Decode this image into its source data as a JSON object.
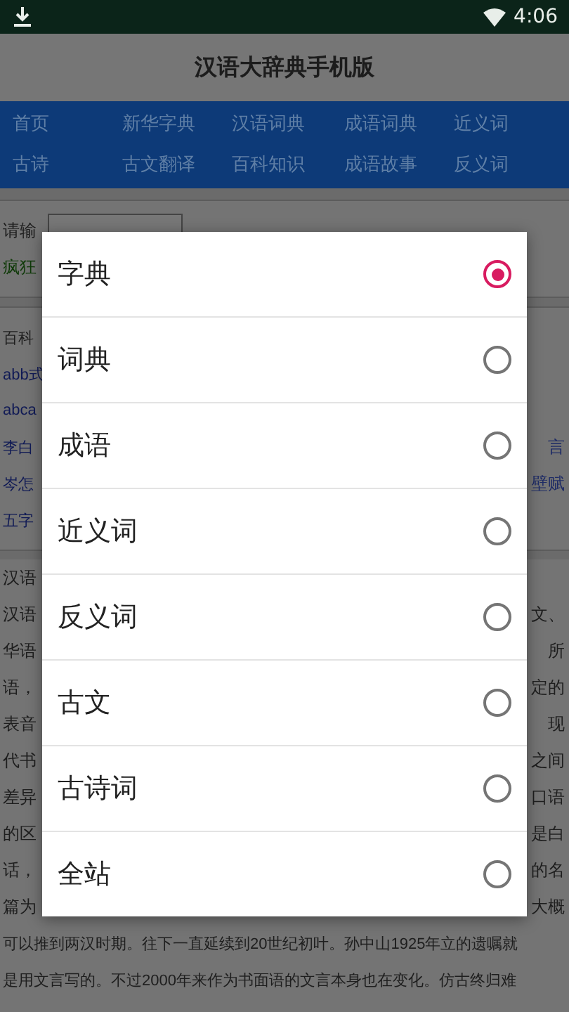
{
  "status_bar": {
    "time": "4:06"
  },
  "header": {
    "title": "汉语大辞典手机版"
  },
  "nav": [
    {
      "label": "首页"
    },
    {
      "label": "新华字典"
    },
    {
      "label": "汉语词典"
    },
    {
      "label": "成语词典"
    },
    {
      "label": "近义词"
    },
    {
      "label": "古诗"
    },
    {
      "label": "古文翻译"
    },
    {
      "label": "百科知识"
    },
    {
      "label": "成语故事"
    },
    {
      "label": "反义词"
    }
  ],
  "search_section": {
    "prompt": "请输",
    "hot": "疯狂"
  },
  "links_section": [
    {
      "left": "百科"
    },
    {
      "left": "abb式"
    },
    {
      "left": "abca"
    },
    {
      "left": "李白",
      "right": "言"
    },
    {
      "left": "岑怎",
      "right": "壁赋"
    },
    {
      "left": "五字"
    }
  ],
  "article": {
    "lines": [
      {
        "left": "汉语"
      },
      {
        "left": "汉语",
        "right": "文、"
      },
      {
        "left": "华语",
        "right": "所"
      },
      {
        "left": "语，",
        "right": "定的"
      },
      {
        "left": "表音",
        "right": "现"
      },
      {
        "left": "代书",
        "right": "之间"
      },
      {
        "left": "差异",
        "right": "口语"
      },
      {
        "left": "的区",
        "right": "是白"
      },
      {
        "left": "话，",
        "right": "的名"
      },
      {
        "left": "篇为",
        "right": "大概"
      },
      {
        "left": "可以推到两汉时期。往下一直延续到20世纪初叶。孙中山1925年立的遗嘱就"
      },
      {
        "left": "是用文言写的。不过2000年来作为书面语的文言本身也在变化。仿古终归难"
      }
    ]
  },
  "dialog": {
    "options": [
      {
        "label": "字典",
        "selected": true
      },
      {
        "label": "词典",
        "selected": false
      },
      {
        "label": "成语",
        "selected": false
      },
      {
        "label": "近义词",
        "selected": false
      },
      {
        "label": "反义词",
        "selected": false
      },
      {
        "label": "古文",
        "selected": false
      },
      {
        "label": "古诗词",
        "selected": false
      },
      {
        "label": "全站",
        "selected": false
      }
    ]
  }
}
